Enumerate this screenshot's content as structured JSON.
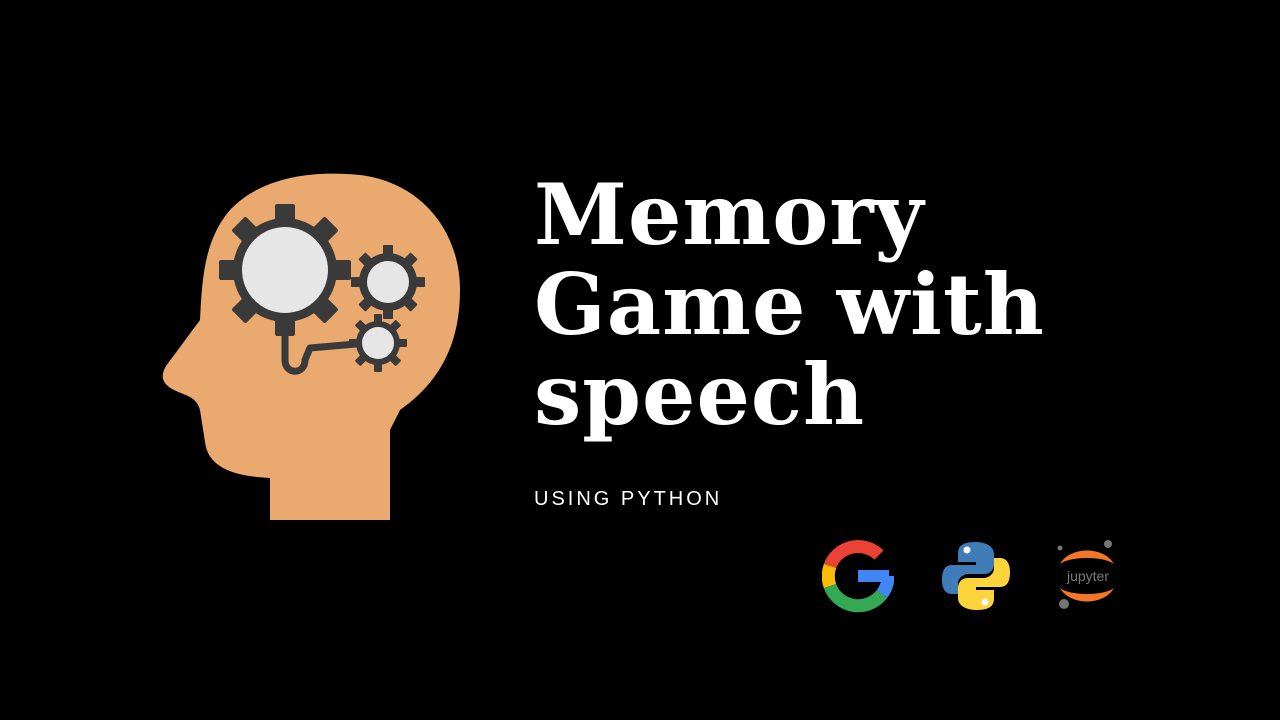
{
  "title": {
    "line1": "Memory",
    "line2": "Game with",
    "line3": "speech"
  },
  "subtitle": "USING PYTHON",
  "logos": {
    "jupyter_label": "jupyter"
  },
  "colors": {
    "background": "#000000",
    "head": "#eaa96e",
    "gear": "#3a3a3a",
    "gear_center": "#e6e6e6",
    "text": "#ffffff"
  },
  "icons": [
    "head-gears-icon",
    "google-icon",
    "python-icon",
    "jupyter-icon"
  ]
}
